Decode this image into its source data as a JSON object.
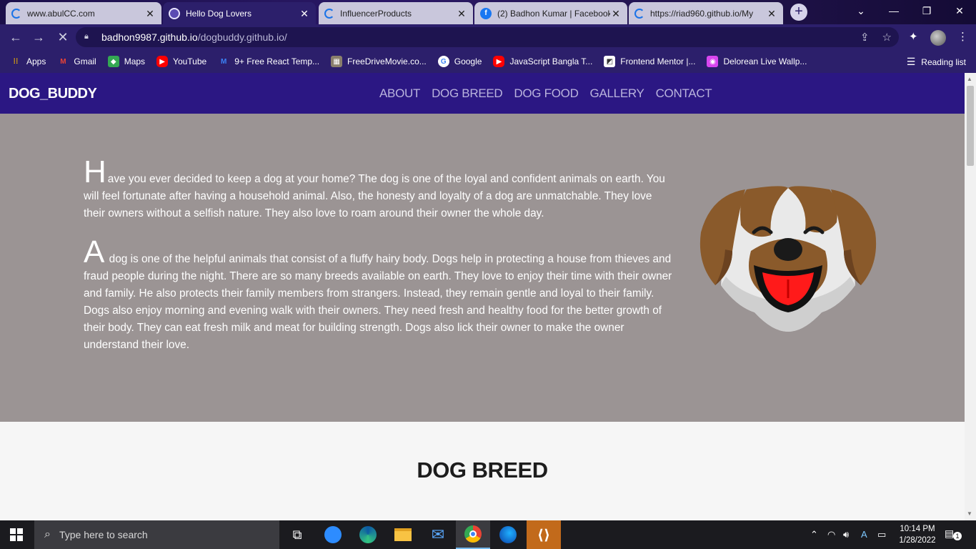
{
  "browser": {
    "tabs": [
      {
        "title": "www.abulCC.com",
        "active": false
      },
      {
        "title": "Hello Dog Lovers",
        "active": true
      },
      {
        "title": "InfluencerProducts",
        "active": false
      },
      {
        "title": "(2) Badhon Kumar | Facebook",
        "active": false
      },
      {
        "title": "https://riad960.github.io/My",
        "active": false
      }
    ],
    "url_host": "badhon9987.github.io",
    "url_path": "/dogbuddy.github.io/",
    "bookmarks": [
      {
        "label": "Apps",
        "icon": "apps-grid-icon",
        "color": "#f4b400"
      },
      {
        "label": "Gmail",
        "icon": "gmail-icon",
        "color": "#ea4335"
      },
      {
        "label": "Maps",
        "icon": "maps-icon",
        "color": "#34a853"
      },
      {
        "label": "YouTube",
        "icon": "youtube-icon",
        "color": "#ff0000"
      },
      {
        "label": "9+ Free React Temp...",
        "icon": "react-template-icon",
        "color": "#3b82f6"
      },
      {
        "label": "FreeDriveMovie.co...",
        "icon": "freedrivemovie-icon",
        "color": "#8a7f6c"
      },
      {
        "label": "Google",
        "icon": "google-icon",
        "color": "#4285f4"
      },
      {
        "label": "JavaScript Bangla T...",
        "icon": "youtube-icon",
        "color": "#ff0000"
      },
      {
        "label": "Frontend Mentor |...",
        "icon": "frontend-mentor-icon",
        "color": "#ffffff"
      },
      {
        "label": "Delorean Live Wallp...",
        "icon": "delorean-icon",
        "color": "#d946ef"
      }
    ],
    "reading_list": "Reading list"
  },
  "site": {
    "brand": "DOG_BUDDY",
    "menu": [
      "ABOUT",
      "DOG BREED",
      "DOG FOOD",
      "GALLERY",
      "CONTACT"
    ],
    "about": {
      "p1_cap": "H",
      "p1": "ave you ever decided to keep a dog at your home? The dog is one of the loyal and confident animals on earth. You will feel fortunate after having a household animal. Also, the honesty and loyalty of a dog are unmatchable. They love their owners without a selfish nature. They also love to roam around their owner the whole day.",
      "p2_cap": "A",
      "p2": " dog is one of the helpful animals that consist of a fluffy hairy body. Dogs help in protecting a house from thieves and fraud people during the night. There are so many breeds available on earth. They love to enjoy their time with their owner and family. He also protects their family members from strangers. Instead, they remain gentle and loyal to their family. Dogs also enjoy morning and evening walk with their owners. They need fresh and healthy food for the better growth of their body. They can eat fresh milk and meat for building strength. Dogs also lick their owner to make the owner understand their love."
    },
    "breed_title": "DOG BREED"
  },
  "taskbar": {
    "search_placeholder": "Type here to search",
    "time": "10:14 PM",
    "date": "1/28/2022",
    "notifications": "1"
  },
  "colors": {
    "nav_bg": "#2b1783",
    "about_bg": "#9b9494",
    "dog_brown": "#8a5a2b",
    "dog_tongue": "#ff1a1a"
  }
}
